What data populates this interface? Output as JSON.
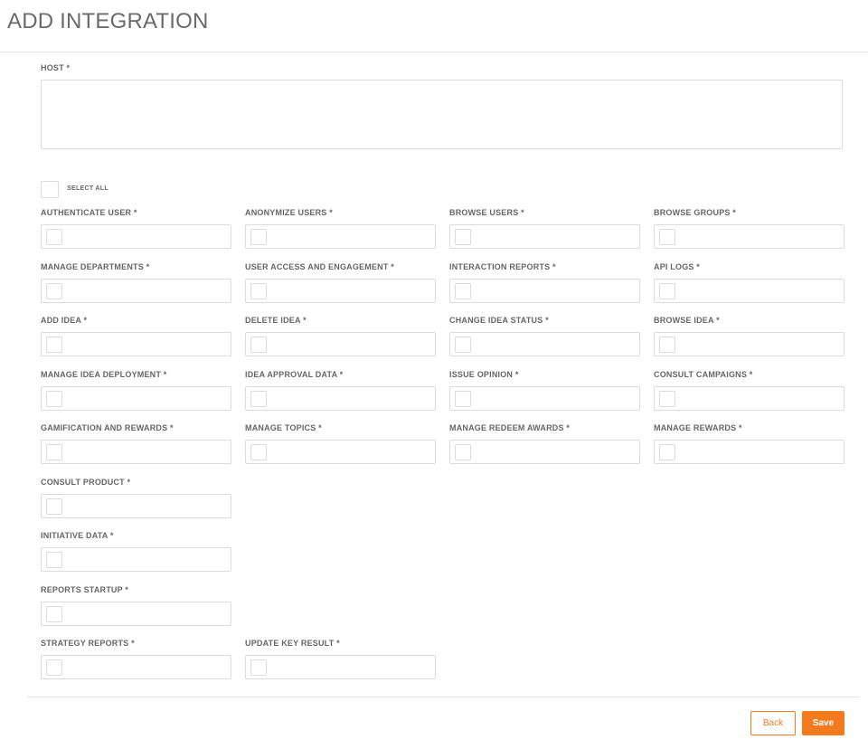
{
  "page": {
    "title": "ADD INTEGRATION"
  },
  "host": {
    "label": "HOST *",
    "value": ""
  },
  "select_all": {
    "label": "SELECT ALL",
    "checked": false
  },
  "permissions": [
    {
      "label": "AUTHENTICATE USER *",
      "checked": false
    },
    {
      "label": "ANONYMIZE USERS *",
      "checked": false
    },
    {
      "label": "BROWSE USERS *",
      "checked": false
    },
    {
      "label": "BROWSE GROUPS *",
      "checked": false
    },
    {
      "label": "MANAGE DEPARTMENTS *",
      "checked": false
    },
    {
      "label": "USER ACCESS AND ENGAGEMENT *",
      "checked": false
    },
    {
      "label": "INTERACTION REPORTS *",
      "checked": false
    },
    {
      "label": "API LOGS *",
      "checked": false
    },
    {
      "label": "ADD IDEA *",
      "checked": false
    },
    {
      "label": "DELETE IDEA *",
      "checked": false
    },
    {
      "label": "CHANGE IDEA STATUS *",
      "checked": false
    },
    {
      "label": "BROWSE IDEA *",
      "checked": false
    },
    {
      "label": "MANAGE IDEA DEPLOYMENT *",
      "checked": false
    },
    {
      "label": "IDEA APPROVAL DATA *",
      "checked": false
    },
    {
      "label": "ISSUE OPINION *",
      "checked": false
    },
    {
      "label": "CONSULT CAMPAIGNS *",
      "checked": false
    },
    {
      "label": "GAMIFICATION AND REWARDS *",
      "checked": false
    },
    {
      "label": "MANAGE TOPICS *",
      "checked": false
    },
    {
      "label": "MANAGE REDEEM AWARDS *",
      "checked": false
    },
    {
      "label": "MANAGE REWARDS *",
      "checked": false
    },
    {
      "label": "CONSULT PRODUCT *",
      "checked": false
    },
    {
      "label": "INITIATIVE DATA *",
      "checked": false
    },
    {
      "label": "REPORTS STARTUP *",
      "checked": false
    },
    {
      "label": "STRATEGY REPORTS *",
      "checked": false
    },
    {
      "label": "UPDATE KEY RESULT *",
      "checked": false
    }
  ],
  "footer": {
    "back_label": "Back",
    "save_label": "Save"
  },
  "colors": {
    "accent": "#f47a20",
    "border": "#dcdcdc",
    "label": "#666666"
  }
}
